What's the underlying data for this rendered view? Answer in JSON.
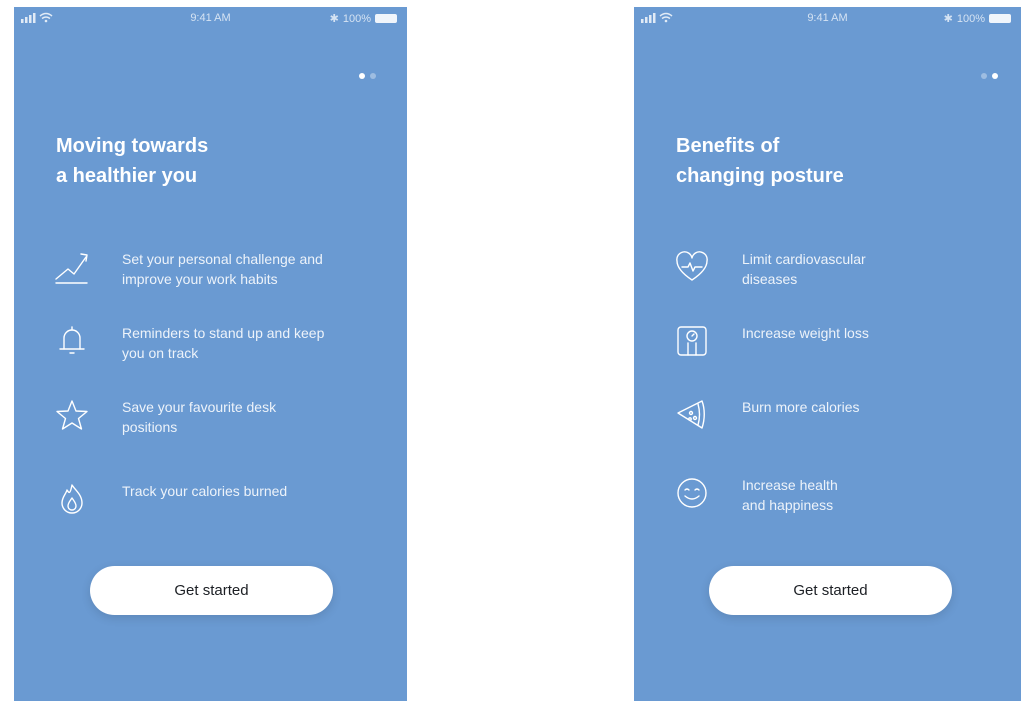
{
  "status_bar": {
    "time": "9:41 AM",
    "battery": "100%",
    "bluetooth_glyph": "✱"
  },
  "screens": [
    {
      "title": "Moving towards\na healthier you",
      "active_page": 0,
      "features": [
        {
          "icon": "chart-trend-icon",
          "text": "Set your personal challenge and\nimprove your work habits"
        },
        {
          "icon": "bell-icon",
          "text": "Reminders to stand up and keep\nyou on track"
        },
        {
          "icon": "star-icon",
          "text": "Save your favourite desk\npositions"
        },
        {
          "icon": "flame-icon",
          "text": "Track your calories burned"
        }
      ],
      "cta_label": "Get started"
    },
    {
      "title": "Benefits of\nchanging posture",
      "active_page": 1,
      "features": [
        {
          "icon": "heart-pulse-icon",
          "text": "Limit cardiovascular\ndiseases"
        },
        {
          "icon": "weight-scale-icon",
          "text": "Increase weight loss"
        },
        {
          "icon": "pizza-slice-icon",
          "text": "Burn more calories"
        },
        {
          "icon": "smiley-icon",
          "text": "Increase health\nand happiness"
        }
      ],
      "cta_label": "Get started"
    }
  ],
  "colors": {
    "background": "#6a9ad2",
    "button": "#ffffff",
    "button_text": "#1c1f24"
  }
}
